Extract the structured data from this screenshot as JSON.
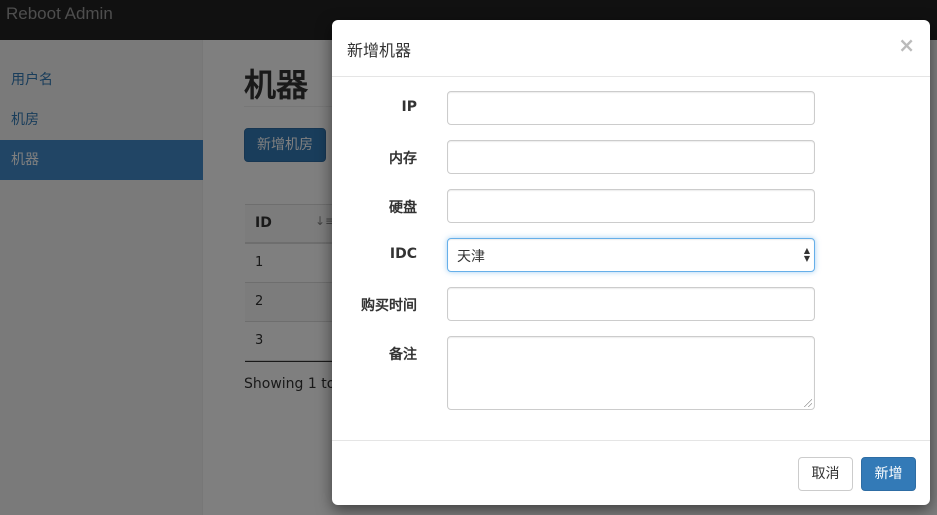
{
  "navbar": {
    "brand": "Reboot Admin"
  },
  "sidebar": {
    "items": [
      {
        "label": "用户名"
      },
      {
        "label": "机房"
      },
      {
        "label": "机器"
      }
    ]
  },
  "main": {
    "title": "机器",
    "add_room_button": "新增机房",
    "table": {
      "headers": [
        "ID"
      ],
      "rows": [
        "1",
        "2",
        "3"
      ]
    },
    "showing_text": "Showing 1 to"
  },
  "modal": {
    "title": "新增机器",
    "close_symbol": "×",
    "fields": {
      "ip": {
        "label": "IP",
        "value": ""
      },
      "memory": {
        "label": "内存",
        "value": ""
      },
      "disk": {
        "label": "硬盘",
        "value": ""
      },
      "idc": {
        "label": "IDC",
        "selected": "天津"
      },
      "purchase_time": {
        "label": "购买时间",
        "value": ""
      },
      "remark": {
        "label": "备注",
        "value": ""
      }
    },
    "cancel_button": "取消",
    "submit_button": "新增"
  }
}
